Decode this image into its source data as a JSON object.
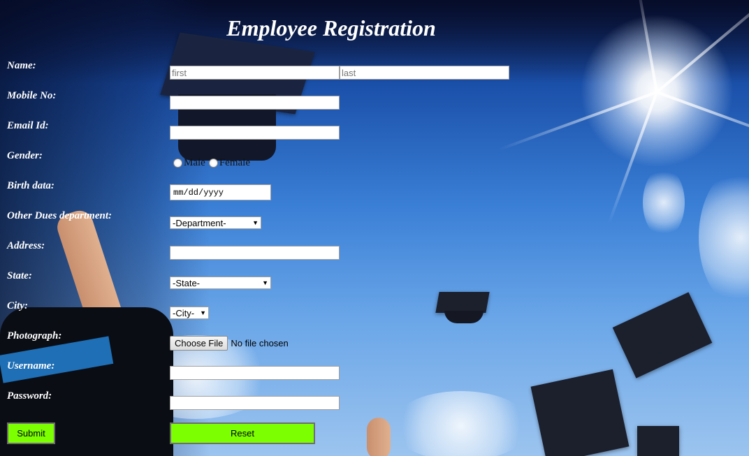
{
  "page": {
    "title": "Employee Registration"
  },
  "form": {
    "name": {
      "label": "Name:",
      "first_placeholder": "first",
      "last_placeholder": "last"
    },
    "mobile": {
      "label": "Mobile No:"
    },
    "email": {
      "label": "Email Id:"
    },
    "gender": {
      "label": "Gender:",
      "options": [
        "Male",
        "Female"
      ]
    },
    "birth": {
      "label": "Birth data:",
      "value": "mm/dd/yyyy"
    },
    "department": {
      "label": "Other Dues department:",
      "selected": "-Department-"
    },
    "address": {
      "label": "Address:"
    },
    "state": {
      "label": "State:",
      "selected": "-State-"
    },
    "city": {
      "label": "City:",
      "selected": "-City-"
    },
    "photograph": {
      "label": "Photograph:",
      "button": "Choose File",
      "status": "No file chosen"
    },
    "username": {
      "label": "Username:"
    },
    "password": {
      "label": "Password:"
    },
    "submit_label": "Submit",
    "reset_label": "Reset"
  },
  "colors": {
    "button_green": "#7cff00",
    "label_text": "#ffffff"
  },
  "icons": {
    "select_arrow": "triangle-down-icon",
    "radio": "radio-unselected-icon"
  }
}
